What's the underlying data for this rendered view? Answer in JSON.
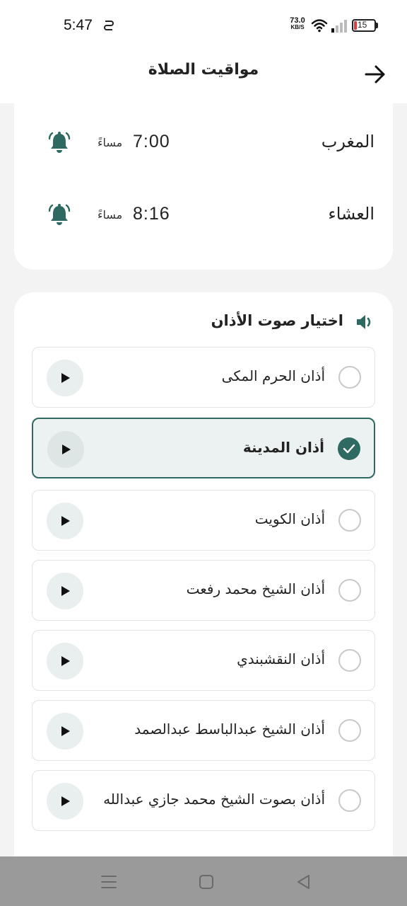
{
  "status_bar": {
    "time": "5:47",
    "net_speed": "73.0",
    "net_unit": "KB/S",
    "battery_level": "15"
  },
  "header": {
    "title": "مواقيت الصلاة"
  },
  "prayers": [
    {
      "name": "المغرب",
      "time": "7:00",
      "period": "مساءً"
    },
    {
      "name": "العشاء",
      "time": "8:16",
      "period": "مساءً"
    }
  ],
  "adhan_section": {
    "title": "اختيار صوت الأذان",
    "options": [
      {
        "label": "أذان الحرم المكى",
        "selected": false
      },
      {
        "label": "أذان المدينة",
        "selected": true
      },
      {
        "label": "أذان الكويت",
        "selected": false
      },
      {
        "label": "أذان الشيخ محمد رفعت",
        "selected": false
      },
      {
        "label": "أذان النقشبندي",
        "selected": false
      },
      {
        "label": "أذان الشيخ عبدالباسط عبدالصمد",
        "selected": false
      },
      {
        "label": "أذان بصوت الشيخ محمد جازي عبدالله",
        "selected": false
      }
    ]
  },
  "colors": {
    "accent": "#2e6a62",
    "selected_bg": "#ecf2f1",
    "nav_bar": "#9a9a9a"
  },
  "icons": {
    "back": "arrow-right-icon",
    "bell": "bell-icon",
    "speaker": "speaker-icon",
    "play": "play-icon",
    "check": "check-icon",
    "nav_menu": "menu-icon",
    "nav_home": "home-square-icon",
    "nav_back": "back-triangle-icon"
  }
}
